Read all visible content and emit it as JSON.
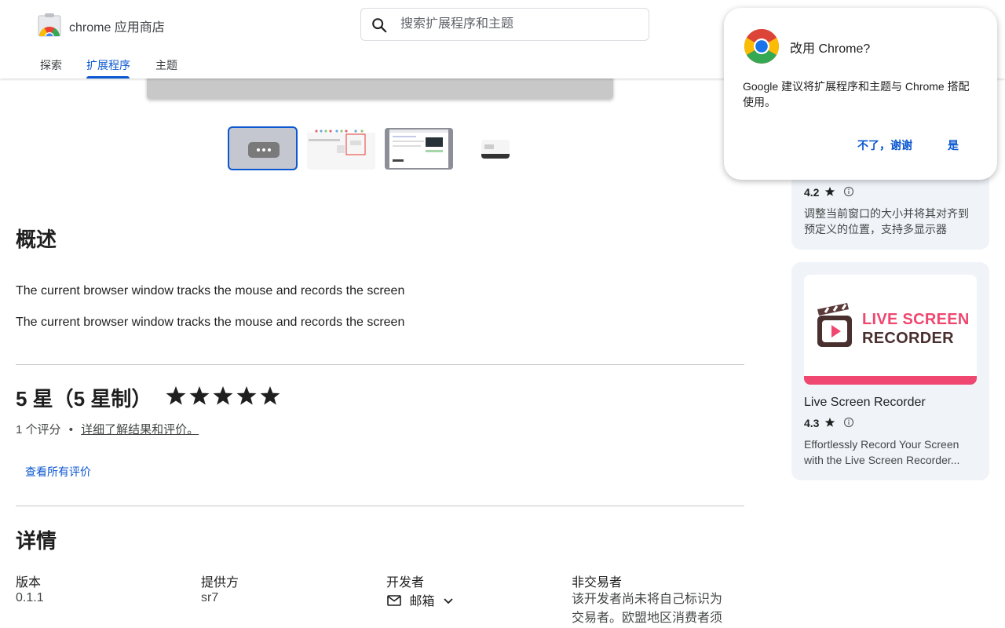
{
  "header": {
    "store_name": "chrome 应用商店",
    "search_placeholder": "搜索扩展程序和主题",
    "tabs": [
      {
        "label": "探索",
        "active": false
      },
      {
        "label": "扩展程序",
        "active": true
      },
      {
        "label": "主题",
        "active": false
      }
    ]
  },
  "overview": {
    "title": "概述",
    "paragraphs": [
      "The current browser window tracks the mouse and records the screen",
      "The current browser window tracks the mouse and records the screen"
    ]
  },
  "rating": {
    "title": "5 星（5 星制）",
    "stars": 5,
    "count_text": "1 个评分",
    "bullet": "•",
    "learn_more": "详细了解结果和评价。",
    "see_all": "查看所有评价"
  },
  "details": {
    "title": "详情",
    "version_label": "版本",
    "version_value": "0.1.1",
    "provider_label": "提供方",
    "provider_value": "sr7",
    "developer_label": "开发者",
    "developer_email": "邮箱",
    "nontrader_label": "非交易者",
    "nontrader_text": "该开发者尚未将自己标识为交易者。欧盟地区消费者须"
  },
  "related": [
    {
      "rating": "4.2",
      "description": "调整当前窗口的大小并将其对齐到预定义的位置，支持多显示器"
    },
    {
      "image_line1": "LIVE SCREEN",
      "image_line2": "RECORDER",
      "title": "Live Screen Recorder",
      "rating": "4.3",
      "description": "Effortlessly Record Your Screen with the Live Screen Recorder..."
    }
  ],
  "popup": {
    "title": "改用 Chrome?",
    "body": "Google 建议将扩展程序和主题与 Chrome 搭配使用。",
    "decline": "不了，谢谢",
    "accept": "是"
  },
  "colors": {
    "accent": "#0b57d0",
    "card_bg": "#f0f4f9",
    "recorder_pink": "#ef476f"
  }
}
